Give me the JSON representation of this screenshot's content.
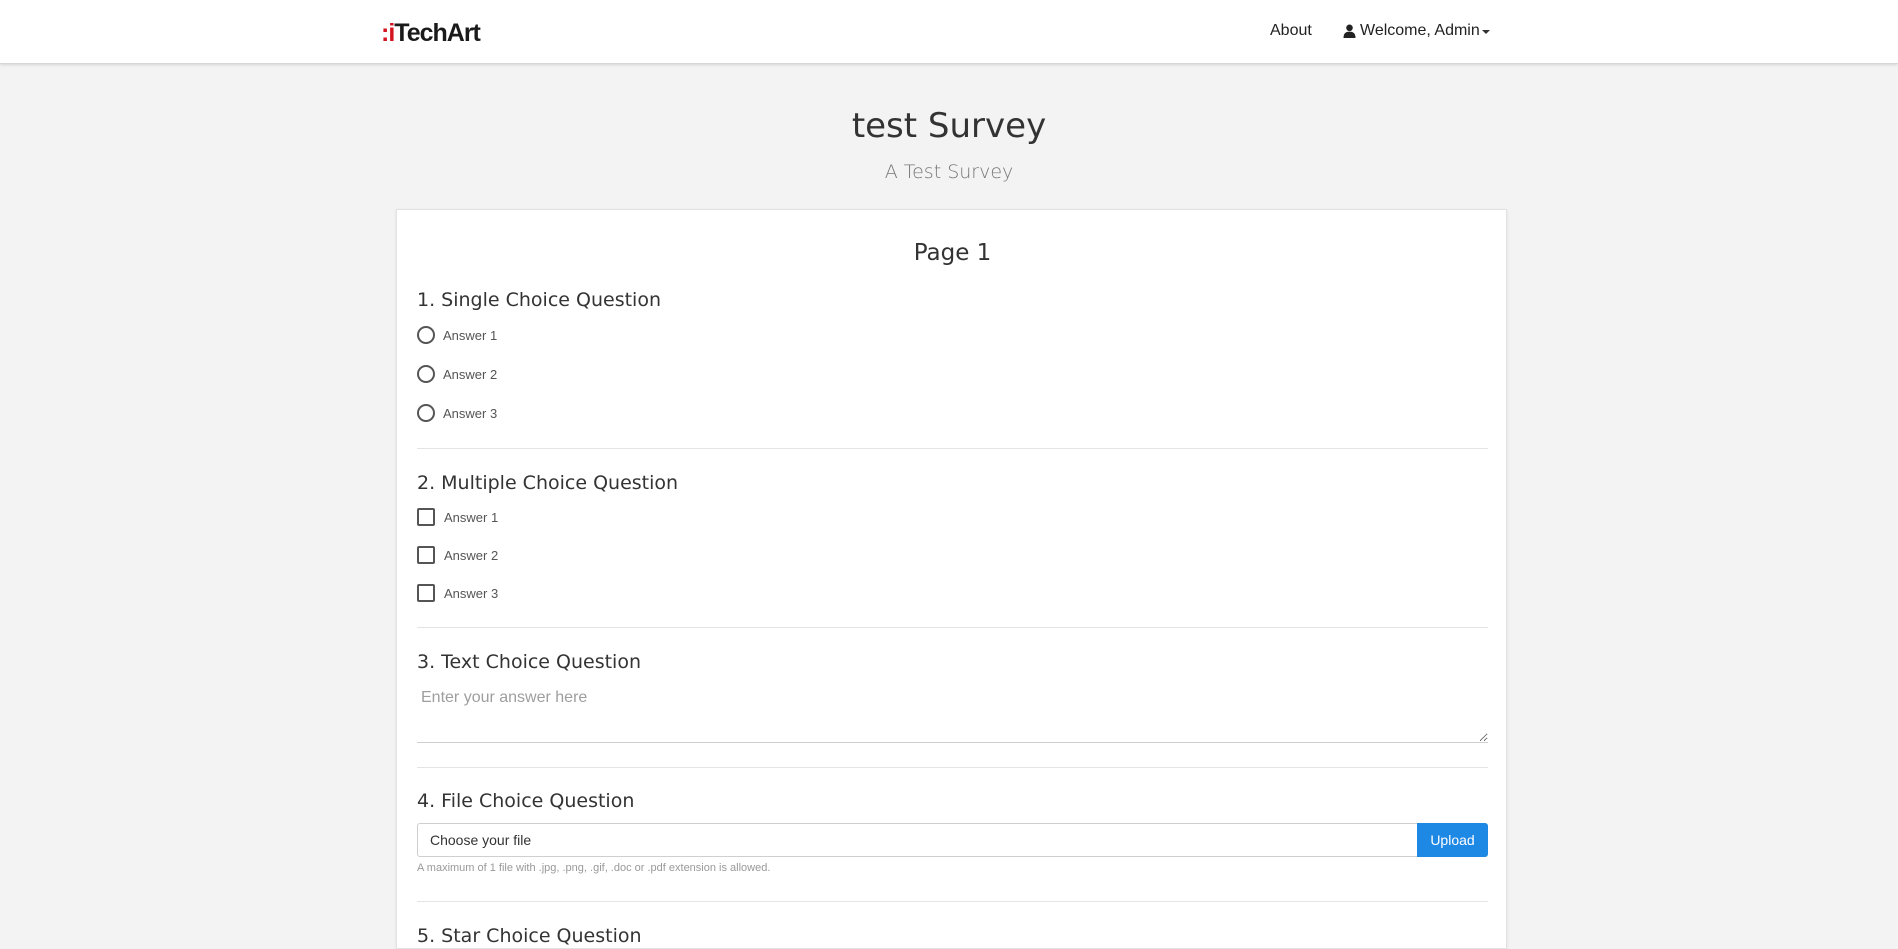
{
  "navbar": {
    "logo_prefix": ":i",
    "logo_main": "TechArt",
    "about_label": "About",
    "user_label": "Welcome, Admin"
  },
  "survey": {
    "title": "test Survey",
    "subtitle": "A Test Survey"
  },
  "page": {
    "title": "Page 1"
  },
  "questions": [
    {
      "title": "1. Single Choice Question",
      "type": "radio",
      "options": [
        "Answer 1",
        "Answer 2",
        "Answer 3"
      ]
    },
    {
      "title": "2. Multiple Choice Question",
      "type": "checkbox",
      "options": [
        "Answer 1",
        "Answer 2",
        "Answer 3"
      ]
    },
    {
      "title": "3. Text Choice Question",
      "type": "text",
      "placeholder": "Enter your answer here"
    },
    {
      "title": "4. File Choice Question",
      "type": "file",
      "file_placeholder": "Choose your file",
      "upload_label": "Upload",
      "hint": "A maximum of 1 file with .jpg, .png, .gif, .doc or .pdf extension is allowed."
    },
    {
      "title": "5. Star Choice Question"
    }
  ],
  "colors": {
    "brand_red": "#d3151f",
    "accent_blue": "#1e88e5",
    "page_background": "#f3f3f3"
  }
}
